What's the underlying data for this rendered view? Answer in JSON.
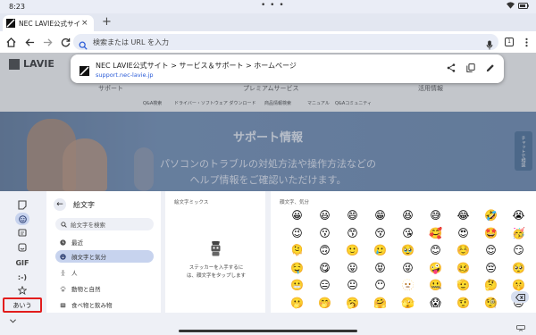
{
  "status": {
    "time": "8:23",
    "dots": "• • •"
  },
  "tab": {
    "title": "NEC LAVIE公式サイト",
    "close": "×",
    "new_tab": "+"
  },
  "omnibox": {
    "placeholder": "検索または URL を入力",
    "tab_count": "1"
  },
  "suggestion": {
    "title": "NEC LAVIE公式サイト > サービス＆サポート > ホームページ",
    "url": "support.nec-lavie.jp"
  },
  "webpage": {
    "logo": "LAVIE",
    "nav": [
      "サポート",
      "プレミアムサービス",
      "活用情報"
    ],
    "subnav": [
      "Q&A検索",
      "ドライバー・ソフトウェア ダウンロード",
      "商品情報検索",
      "マニュアル",
      "Q&Aコミュニティ"
    ],
    "hero_title": "サポート情報",
    "hero_line1": "パソコンのトラブルの対処方法や操作方法などの",
    "hero_line2": "ヘルプ情報をご確認いただけます。",
    "chat_badge": "チャットで相談"
  },
  "keyboard": {
    "rail": {
      "gif": "GIF",
      "emoticon": ":-)",
      "lang_key": "あいう"
    },
    "header": "絵文字",
    "search_placeholder": "絵文字を検索",
    "categories": [
      {
        "label": "最近",
        "icon": "clock-icon"
      },
      {
        "label": "顔文字と気分",
        "icon": "smiley-icon"
      },
      {
        "label": "人",
        "icon": "person-icon"
      },
      {
        "label": "動物と自然",
        "icon": "paw-icon"
      },
      {
        "label": "食べ物と飲み物",
        "icon": "cup-icon"
      }
    ],
    "stickers_label": "絵文字ミックス",
    "stickers_msg_1": "ステッカーを入手するに",
    "stickers_msg_2": "は、顔文字をタップします",
    "emoji_label": "顔文字、気分",
    "emojis": [
      "😀",
      "😃",
      "😄",
      "😁",
      "😆",
      "😅",
      "😂",
      "🤣",
      "😭",
      "😉",
      "😗",
      "😙",
      "😚",
      "😘",
      "🥰",
      "😍",
      "🤩",
      "🥳",
      "🫠",
      "🙃",
      "🙂",
      "🥲",
      "🥹",
      "😊",
      "☺️",
      "😌",
      "😏",
      "🤤",
      "😋",
      "😛",
      "😝",
      "😜",
      "🤪",
      "🥴",
      "😔",
      "🥺",
      "😬",
      "😑",
      "😐",
      "😶",
      "🫥",
      "🤐",
      "🫡",
      "🤔",
      "🤫",
      "🫢",
      "🤭",
      "🥱",
      "🤗",
      "🫣",
      "😱",
      "🤨",
      "🧐",
      "😒"
    ]
  },
  "colors": {
    "highlight_box": "#e21d1d",
    "selected_pill": "#c7d3ee",
    "url_blue": "#2a5bd7"
  }
}
